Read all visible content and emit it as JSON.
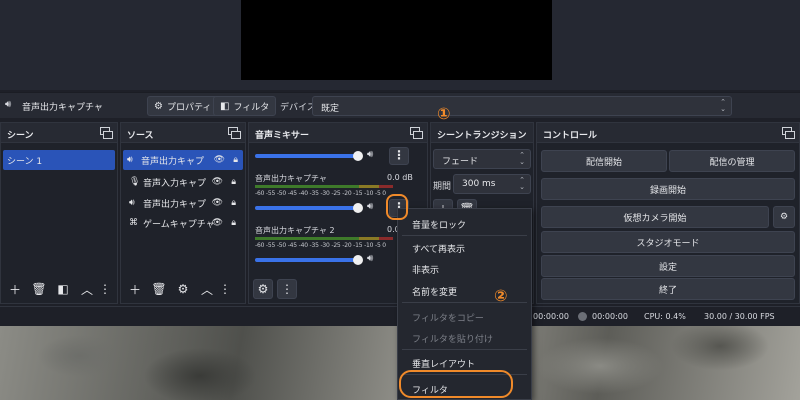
{
  "source_toolbar": {
    "source_name": "音声出力キャプチャ",
    "properties_label": "プロパティ",
    "filters_label": "フィルタ",
    "device_label": "デバイス",
    "device_value": "既定"
  },
  "scenes": {
    "title": "シーン",
    "items": [
      "シーン 1"
    ]
  },
  "sources": {
    "title": "ソース",
    "items": [
      {
        "label": "音声出力キャプ",
        "icon": "speaker-icon"
      },
      {
        "label": "音声入力キャプ",
        "icon": "microphone-icon"
      },
      {
        "label": "音声出力キャプ",
        "icon": "speaker-icon"
      },
      {
        "label": "ゲームキャプチャ",
        "icon": "gamepad-icon"
      }
    ]
  },
  "mixer": {
    "title": "音声ミキサー",
    "channels": [
      {
        "name": "音声出力キャプチャ",
        "db": "0.0 dB"
      },
      {
        "name": "音声出力キャプチャ 2",
        "db": "0.0 dB"
      }
    ],
    "scale": "-60 -55 -50 -45 -40 -35 -30 -25 -20 -15 -10 -5 0"
  },
  "transitions": {
    "title": "シーントランジション",
    "type": "フェード",
    "duration_label": "期間",
    "duration_value": "300 ms"
  },
  "controls": {
    "title": "コントロール",
    "start_streaming": "配信開始",
    "manage_stream": "配信の管理",
    "start_recording": "録画開始",
    "virtual_camera": "仮想カメラ開始",
    "studio_mode": "スタジオモード",
    "settings": "設定",
    "exit": "終了"
  },
  "status": {
    "rec_time": "00:00:00",
    "cpu": "CPU: 0.4%",
    "fps": "30.00 / 30.00 FPS"
  },
  "context_menu": {
    "items": [
      "音量をロック",
      "すべて再表示",
      "非表示",
      "名前を変更",
      "フィルタをコピー",
      "フィルタを貼り付け",
      "垂直レイアウト",
      "フィルタ"
    ]
  },
  "annotations": {
    "one": "①",
    "two": "②"
  },
  "colors": {
    "accent": "#2a54b8",
    "slider": "#3a72e8",
    "annotation": "#f08a2a"
  }
}
